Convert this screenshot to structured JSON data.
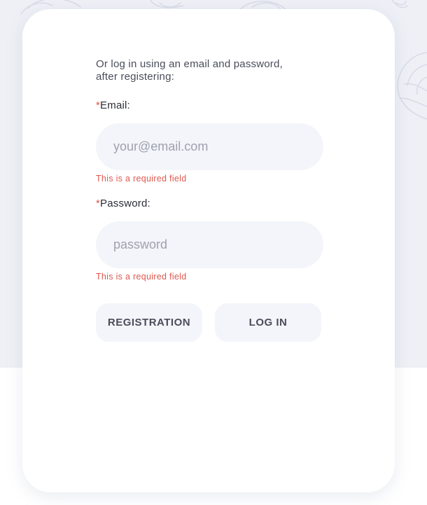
{
  "login": {
    "intro_text": "Or log in using an email and password, after registering:",
    "required_marker": "*",
    "email": {
      "label": "Email:",
      "placeholder": "your@email.com",
      "value": "",
      "error": "This is a required field"
    },
    "password": {
      "label": "Password:",
      "placeholder": "password",
      "value": "",
      "error": "This is a required field"
    },
    "buttons": {
      "registration_label": "REGISTRATION",
      "login_label": "LOG IN"
    }
  },
  "colors": {
    "background_top": "#eef0f6",
    "card": "#ffffff",
    "input_fill": "#f3f5fa",
    "error": "#e0584f",
    "text": "#2b2d36",
    "button_text": "#4a4d5a"
  },
  "decorations": {
    "background_pattern": "cabbage-doodle-icons"
  }
}
